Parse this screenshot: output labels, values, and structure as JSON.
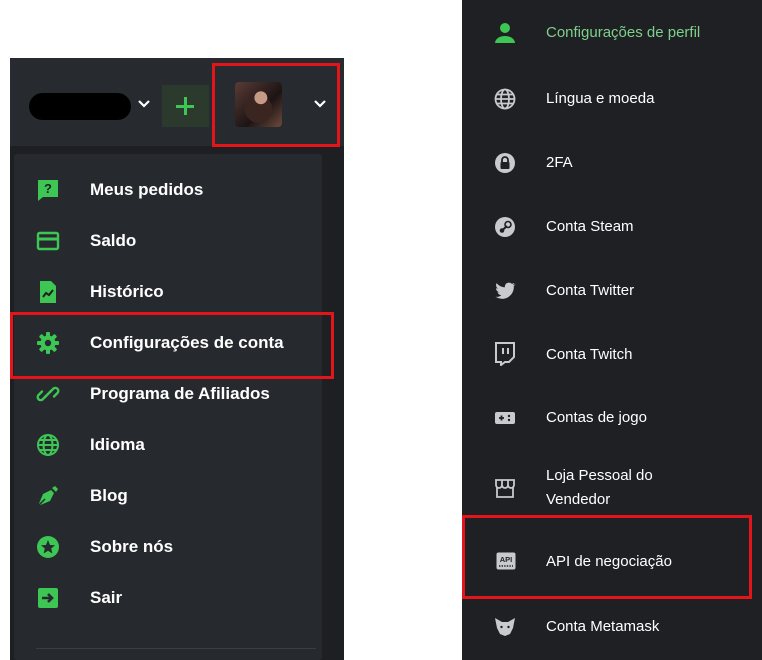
{
  "left_menu": {
    "items": [
      {
        "label": "Meus pedidos",
        "icon": "question-chat-icon"
      },
      {
        "label": "Saldo",
        "icon": "credit-card-icon"
      },
      {
        "label": "Histórico",
        "icon": "chart-file-icon"
      },
      {
        "label": "Configurações de conta",
        "icon": "gear-icon"
      },
      {
        "label": "Programa de Afiliados",
        "icon": "link-icon"
      },
      {
        "label": "Idioma",
        "icon": "globe-icon"
      },
      {
        "label": "Blog",
        "icon": "pen-nib-icon"
      },
      {
        "label": "Sobre nós",
        "icon": "star-circle-icon"
      },
      {
        "label": "Sair",
        "icon": "exit-arrow-icon"
      }
    ]
  },
  "right_menu": {
    "items": [
      {
        "label": "Configurações de perfil",
        "icon": "user-icon",
        "active": true
      },
      {
        "label": "Língua e moeda",
        "icon": "globe-icon"
      },
      {
        "label": "2FA",
        "icon": "lock-icon"
      },
      {
        "label": "Conta Steam",
        "icon": "steam-icon"
      },
      {
        "label": "Conta Twitter",
        "icon": "twitter-icon"
      },
      {
        "label": "Conta Twitch",
        "icon": "twitch-icon"
      },
      {
        "label": "Contas de jogo",
        "icon": "gamepad-icon"
      },
      {
        "label_line1": "Loja Pessoal do",
        "label_line2": "Vendedor",
        "icon": "store-icon"
      },
      {
        "label": "API de negociação",
        "icon": "api-icon"
      },
      {
        "label": "Conta Metamask",
        "icon": "fox-icon"
      }
    ]
  },
  "colors": {
    "accent_green": "#3ec654",
    "active_text": "#7fd08a",
    "highlight_red": "#e3151a",
    "panel_bg": "#1e2024"
  }
}
